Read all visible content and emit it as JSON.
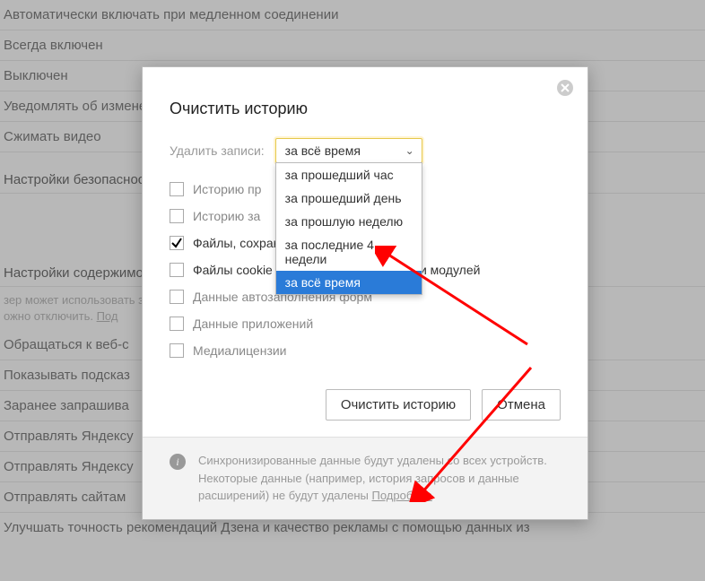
{
  "bg": {
    "lines": [
      "Автоматически включать при медленном соединении",
      "Всегда включен",
      "Выключен",
      "Уведомлять об изменении",
      "Сжимать видео"
    ],
    "section1": "Настройки безопасности",
    "section2": "Настройки содержимого",
    "small_text": "зер может использовать                                                                                                                            зжности вам не нужны,\nожно отключить. ",
    "small_link": "Под",
    "lines2": [
      "Обращаться к веб-с",
      "Показывать подсказ",
      "Заранее запрашива",
      "Отправлять Яндексу",
      "Отправлять Яндексу",
      "Отправлять сайтам"
    ],
    "last": "Улучшать точность рекомендаций Дзена и качество рекламы с помощью данных из"
  },
  "dialog": {
    "title": "Очистить историю",
    "delete_label": "Удалить записи:",
    "selected": "за всё время",
    "options": [
      "за прошедший час",
      "за прошедший день",
      "за прошлую неделю",
      "за последние 4 недели",
      "за всё время"
    ],
    "items": [
      {
        "label": "Историю пр",
        "checked": false
      },
      {
        "label": "Историю за",
        "checked": false
      },
      {
        "label": "Файлы, сохранённые в кэше (497 MB)",
        "checked": true
      },
      {
        "label": "Файлы cookie и другие данные сайтов и модулей",
        "checked": false
      },
      {
        "label": "Данные автозаполнения форм",
        "checked": false
      },
      {
        "label": "Данные приложений",
        "checked": false
      },
      {
        "label": "Медиалицензии",
        "checked": false
      }
    ],
    "clear_btn": "Очистить историю",
    "cancel_btn": "Отмена",
    "footer_text": "Синхронизированные данные будут удалены со всех устройств. Некоторые данные (например, история запросов и данные расширений) не будут удалены ",
    "footer_link": "Подробнее"
  }
}
